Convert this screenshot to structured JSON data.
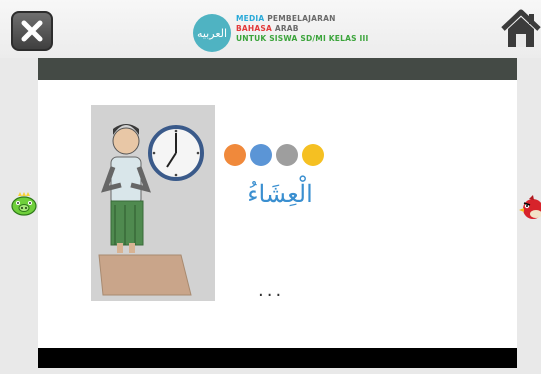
{
  "header": {
    "logo_text": "العربيه",
    "brand_lines": [
      {
        "a": "MEDIA",
        "b": "PEMBELAJARAN"
      },
      {
        "a": "BAHASA",
        "b": "ARAB"
      },
      {
        "a": "UNTUK SISWA SD/MI KELAS III",
        "b": ""
      }
    ]
  },
  "icons": {
    "close": "close-icon",
    "home": "home-icon",
    "prev": "green-pig-icon",
    "next": "red-bird-icon"
  },
  "colors": {
    "brand_cyan": "#29a9d8",
    "brand_red": "#e23a3a",
    "brand_green": "#3ba43b",
    "dark_bar": "#444a45",
    "word": "#3a8fd0"
  },
  "main": {
    "color_dots": [
      "#f0893b",
      "#5b95d6",
      "#9e9e9e",
      "#f5c022"
    ],
    "arabic_word": "الْعِشَاءُ",
    "ellipsis": "..."
  }
}
